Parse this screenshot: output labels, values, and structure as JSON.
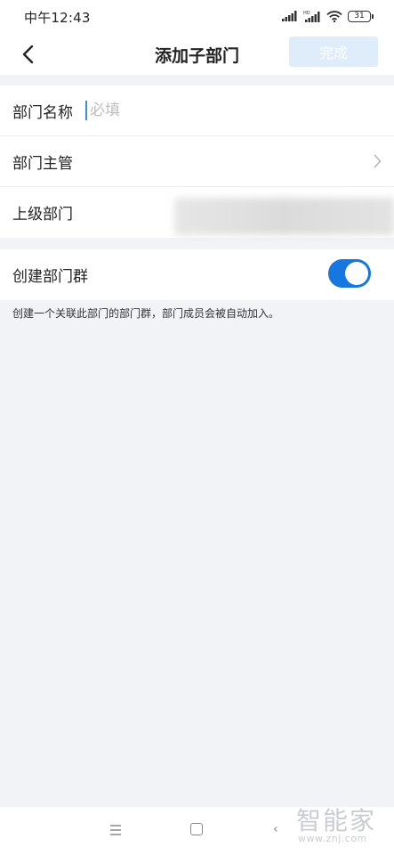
{
  "status_bar": {
    "time": "中午12:43",
    "battery": "31"
  },
  "nav": {
    "title": "添加子部门",
    "done_label": "完成"
  },
  "form": {
    "name_label": "部门名称",
    "name_placeholder": "必填",
    "manager_label": "部门主管",
    "parent_label": "上级部门",
    "group_toggle_label": "创建部门群",
    "group_toggle_on": true,
    "hint": "创建一个关联此部门的部门群，部门成员会被自动加入。"
  },
  "watermark": {
    "main": "智能家",
    "sub": "www.znj.com"
  },
  "colors": {
    "accent": "#1677e0",
    "done_disabled_bg": "#dfedfb",
    "page_bg": "#f1f3f6"
  }
}
